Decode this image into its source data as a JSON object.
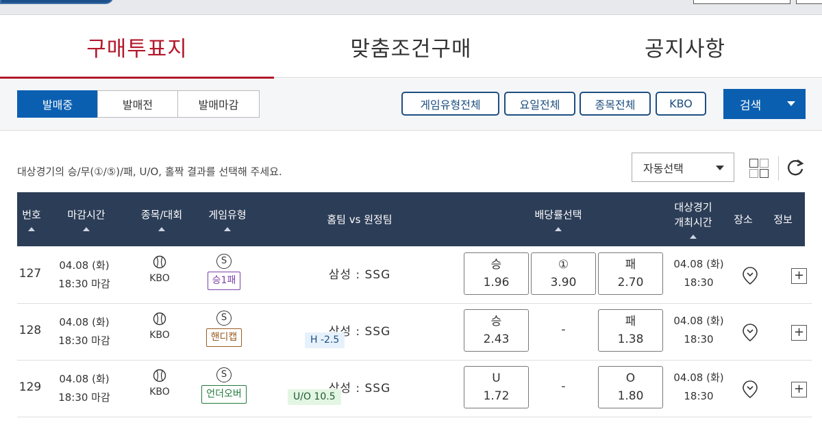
{
  "main_tabs": [
    {
      "label": "구매투표지",
      "active": true
    },
    {
      "label": "맞춤조건구매",
      "active": false
    },
    {
      "label": "공지사항",
      "active": false
    }
  ],
  "status_tabs": [
    {
      "label": "발매중",
      "active": true
    },
    {
      "label": "발매전",
      "active": false
    },
    {
      "label": "발매마감",
      "active": false
    }
  ],
  "filters": [
    "게임유형전체",
    "요일전체",
    "종목전체",
    "KBO"
  ],
  "search_label": "검색",
  "instruction": "대상경기의 승/무(①/⑤)/패, U/O, 홀짝 결과를 선택해 주세요.",
  "auto_select": "자동선택",
  "columns": {
    "num": "번호",
    "deadline": "마감시간",
    "sport": "종목/대회",
    "game_type": "게임유형",
    "match": "홈팀 vs 원정팀",
    "odds": "배당률선택",
    "game_time_line1": "대상경기",
    "game_time_line2": "개최시간",
    "venue": "장소",
    "info": "정보"
  },
  "rows": [
    {
      "num": "127",
      "deadline_date": "04.08 (화)",
      "deadline_time": "18:30 마감",
      "sport": "KBO",
      "game_icon": "S",
      "game_type": "승1패",
      "match": "삼성 : SSG",
      "tag": "",
      "odds": [
        {
          "label": "승",
          "value": "1.96"
        },
        {
          "label": "①",
          "value": "3.90"
        },
        {
          "label": "패",
          "value": "2.70"
        }
      ],
      "game_date": "04.08 (화)",
      "game_time": "18:30"
    },
    {
      "num": "128",
      "deadline_date": "04.08 (화)",
      "deadline_time": "18:30 마감",
      "sport": "KBO",
      "game_icon": "S",
      "game_type": "핸디캡",
      "match": "삼성 : SSG",
      "tag": "H -2.5",
      "odds": [
        {
          "label": "승",
          "value": "2.43"
        },
        {
          "label": "-",
          "value": ""
        },
        {
          "label": "패",
          "value": "1.38"
        }
      ],
      "game_date": "04.08 (화)",
      "game_time": "18:30"
    },
    {
      "num": "129",
      "deadline_date": "04.08 (화)",
      "deadline_time": "18:30 마감",
      "sport": "KBO",
      "game_icon": "S",
      "game_type": "언더오버",
      "match": "삼성 : SSG",
      "tag": "U/O 10.5",
      "odds": [
        {
          "label": "U",
          "value": "1.72"
        },
        {
          "label": "-",
          "value": ""
        },
        {
          "label": "O",
          "value": "1.80"
        }
      ],
      "game_date": "04.08 (화)",
      "game_time": "18:30"
    }
  ],
  "colors": {
    "accent_red": "#b3172b",
    "primary_blue": "#0b5fb0",
    "header_navy": "#2c3d57",
    "badge_purple": "#7a3fa8",
    "badge_brown": "#9a5a1f",
    "badge_green": "#1f7a3a",
    "tag_blue_bg": "#e6f1fb",
    "tag_green_bg": "#e3f6e3"
  }
}
